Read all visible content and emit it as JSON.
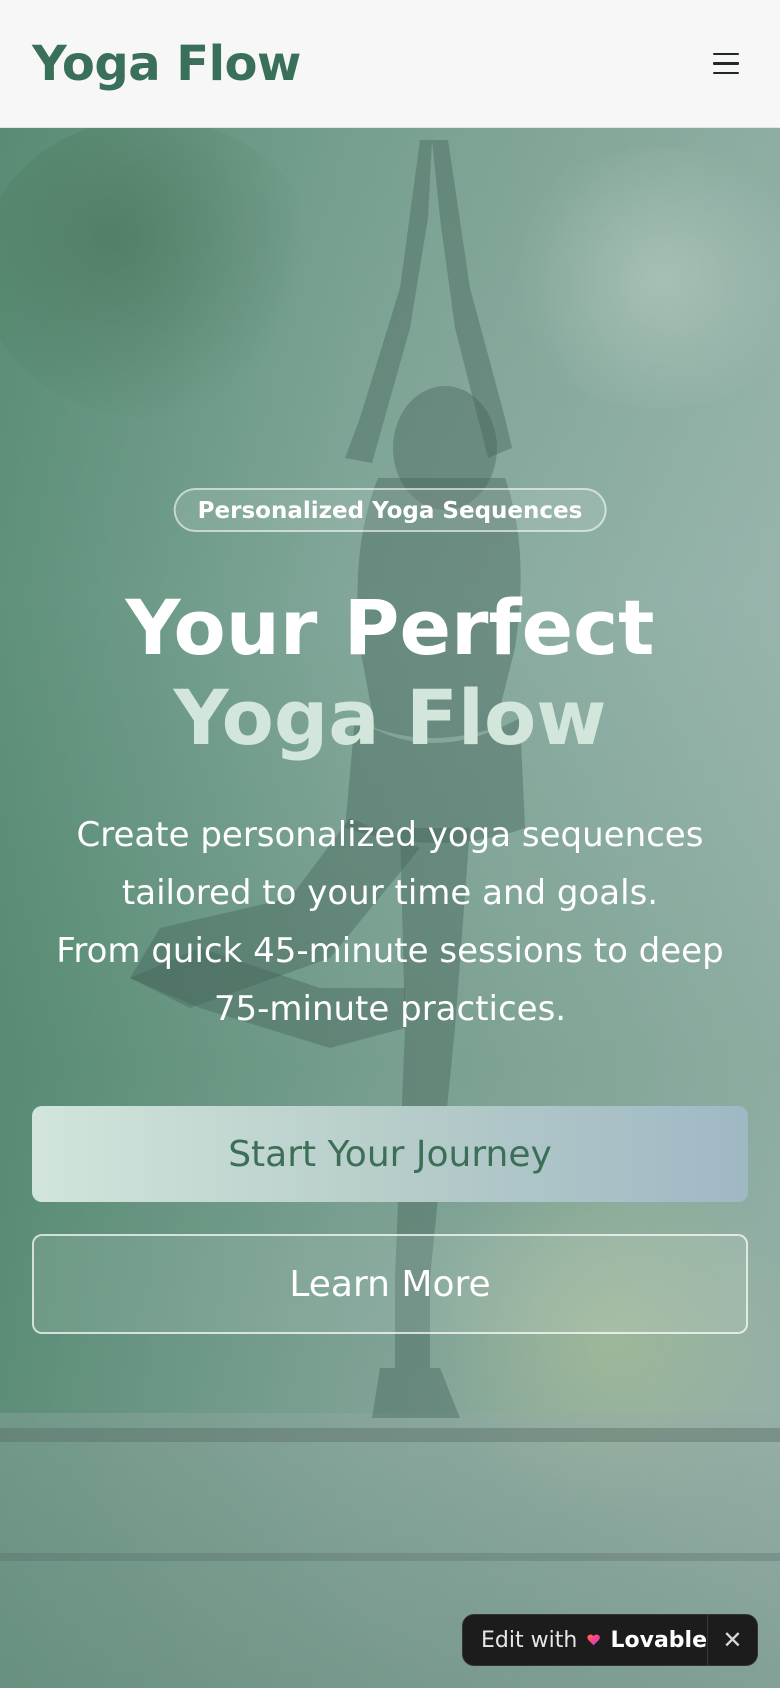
{
  "header": {
    "logo": "Yoga Flow",
    "menu_icon": "hamburger-menu-icon"
  },
  "hero": {
    "badge": "Personalized Yoga Sequences",
    "title_line1": "Your Perfect",
    "title_line2": "Yoga Flow",
    "subtitle_lines": [
      "Create personalized yoga sequences",
      "tailored to your time and goals.",
      "From quick 45-minute sessions to deep",
      "75-minute practices."
    ],
    "primary_button": "Start Your Journey",
    "secondary_button": "Learn More",
    "background_image": "woman-in-tree-pose-yoga-image"
  },
  "lovable_badge": {
    "edit_label": "Edit with",
    "brand": "Lovable",
    "close_icon": "close-icon"
  },
  "colors": {
    "brand_green": "#3a7059",
    "title_accent": "#d3e6dc",
    "header_bg": "#f6f7f6"
  }
}
